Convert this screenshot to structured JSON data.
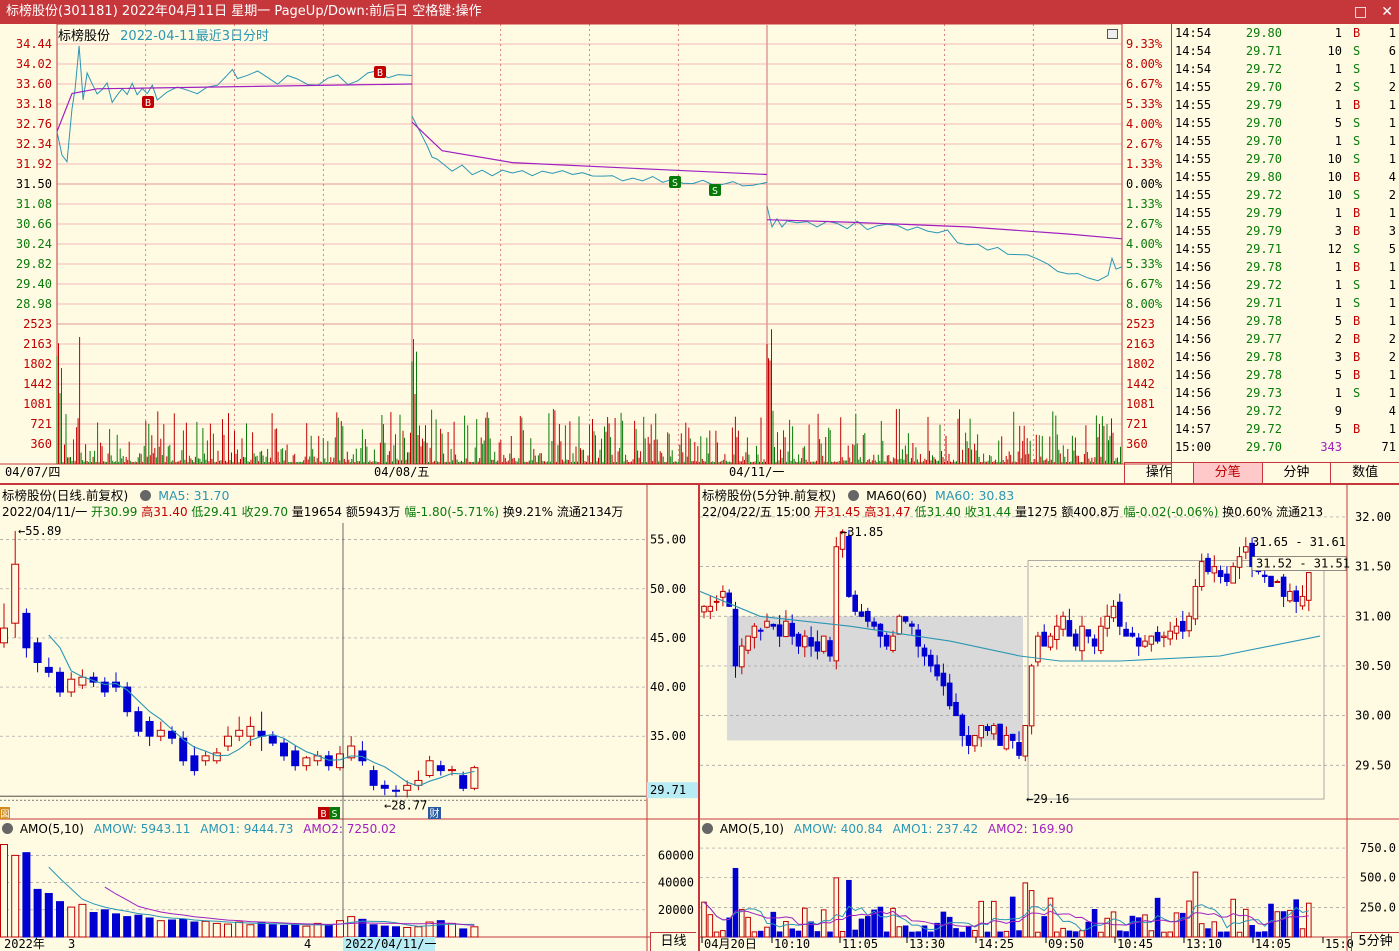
{
  "window": {
    "title": "标榜股份(301181) 2022年04月11日 星期一 PageUp/Down:前后日 空格键:操作",
    "min_glyph": "□",
    "close_glyph": "✕"
  },
  "intraday": {
    "stock_name": "标榜股份",
    "subtitle": "2022-04-11最近3日分时",
    "price_ticks": [
      "34.44",
      "34.02",
      "33.60",
      "33.18",
      "32.76",
      "32.34",
      "31.92",
      "31.50",
      "31.08",
      "30.66",
      "30.24",
      "29.82",
      "29.40",
      "28.98"
    ],
    "pct_ticks": [
      "9.33%",
      "8.00%",
      "6.67%",
      "5.33%",
      "4.00%",
      "2.67%",
      "1.33%",
      "0.00%",
      "1.33%",
      "2.67%",
      "4.00%",
      "5.33%",
      "6.67%",
      "8.00%"
    ],
    "volume_ticks": [
      "2523",
      "2163",
      "1802",
      "1442",
      "1081",
      "721",
      "360"
    ],
    "date_labels": [
      "04/07/四",
      "04/08/五",
      "04/11/一"
    ],
    "marker_b": "B",
    "marker_s": "S",
    "colors": {
      "up": "#c00000",
      "down": "#087a08",
      "price_line": "#2a96b4",
      "avg_line": "#a020c0"
    }
  },
  "tick_table": {
    "rows": [
      [
        "14:54",
        "29.80",
        "1",
        "B",
        "1"
      ],
      [
        "14:54",
        "29.71",
        "10",
        "S",
        "6"
      ],
      [
        "14:54",
        "29.72",
        "1",
        "S",
        "1"
      ],
      [
        "14:55",
        "29.70",
        "2",
        "S",
        "2"
      ],
      [
        "14:55",
        "29.79",
        "1",
        "B",
        "1"
      ],
      [
        "14:55",
        "29.70",
        "5",
        "S",
        "1"
      ],
      [
        "14:55",
        "29.70",
        "1",
        "S",
        "1"
      ],
      [
        "14:55",
        "29.70",
        "10",
        "S",
        "1"
      ],
      [
        "14:55",
        "29.80",
        "10",
        "B",
        "4"
      ],
      [
        "14:55",
        "29.72",
        "10",
        "S",
        "2"
      ],
      [
        "14:55",
        "29.79",
        "1",
        "B",
        "1"
      ],
      [
        "14:55",
        "29.79",
        "3",
        "B",
        "3"
      ],
      [
        "14:55",
        "29.71",
        "12",
        "S",
        "5"
      ],
      [
        "14:56",
        "29.78",
        "1",
        "B",
        "1"
      ],
      [
        "14:56",
        "29.72",
        "1",
        "S",
        "1"
      ],
      [
        "14:56",
        "29.71",
        "1",
        "S",
        "1"
      ],
      [
        "14:56",
        "29.78",
        "5",
        "B",
        "1"
      ],
      [
        "14:56",
        "29.77",
        "2",
        "B",
        "2"
      ],
      [
        "14:56",
        "29.78",
        "3",
        "B",
        "2"
      ],
      [
        "14:56",
        "29.78",
        "5",
        "B",
        "1"
      ],
      [
        "14:56",
        "29.73",
        "1",
        "S",
        "1"
      ],
      [
        "14:56",
        "29.72",
        "9",
        "",
        "4"
      ],
      [
        "14:57",
        "29.72",
        "5",
        "B",
        "1"
      ],
      [
        "15:00",
        "29.70",
        "343",
        "",
        "71"
      ]
    ],
    "tabs": [
      "操作",
      "分笔",
      "分钟",
      "数值"
    ],
    "active_tab": 1
  },
  "daily": {
    "title": "标榜股份(日线.前复权)",
    "ma_label": "MA5: 31.70",
    "info_line": {
      "date": "2022/04/11/一",
      "open": "开30.99",
      "high": "高31.40",
      "low": "低29.41",
      "close": "收29.70",
      "vol": "量19654",
      "amount": "额5943万",
      "change": "幅-1.80(-5.71%)",
      "turnover": "换9.21%",
      "float": "流通2134万"
    },
    "price_axis": [
      "55.00",
      "50.00",
      "45.00",
      "40.00",
      "35.00"
    ],
    "current_price": "29.71",
    "high_label": "55.89",
    "low_label": "28.77",
    "amo_title": "AMO(5,10)",
    "amow": "AMOW: 5943.11",
    "amo1": "AMO1: 9444.73",
    "amo2": "AMO2: 7250.02",
    "amo_axis": [
      "60000",
      "40000",
      "20000"
    ],
    "date_axis": [
      "2022年",
      "3",
      "4",
      "2022/04/11/一"
    ],
    "period_tab": "日线",
    "badge_b": "B",
    "badge_s": "S",
    "badge_cai": "财",
    "badge_left": "図",
    "daily_candles": [
      {
        "o": 44.5,
        "c": 46.0,
        "h": 48.5,
        "l": 44.0
      },
      {
        "o": 46.5,
        "c": 52.5,
        "h": 55.89,
        "l": 45.0
      },
      {
        "o": 47.5,
        "c": 44.0,
        "h": 48.0,
        "l": 43.0
      },
      {
        "o": 44.5,
        "c": 42.5,
        "h": 45.0,
        "l": 41.5
      },
      {
        "o": 42.0,
        "c": 41.5,
        "h": 43.0,
        "l": 41.0
      },
      {
        "o": 41.5,
        "c": 39.5,
        "h": 42.0,
        "l": 39.0
      },
      {
        "o": 39.5,
        "c": 40.8,
        "h": 41.5,
        "l": 39.0
      },
      {
        "o": 40.2,
        "c": 41.0,
        "h": 41.8,
        "l": 39.8
      },
      {
        "o": 41.0,
        "c": 40.5,
        "h": 41.5,
        "l": 40.0
      },
      {
        "o": 40.5,
        "c": 39.5,
        "h": 41.0,
        "l": 39.0
      },
      {
        "o": 40.5,
        "c": 40.0,
        "h": 41.5,
        "l": 39.5
      },
      {
        "o": 40.0,
        "c": 37.5,
        "h": 40.5,
        "l": 37.0
      },
      {
        "o": 37.5,
        "c": 35.5,
        "h": 38.0,
        "l": 35.0
      },
      {
        "o": 36.5,
        "c": 35.0,
        "h": 37.0,
        "l": 34.0
      },
      {
        "o": 35.0,
        "c": 35.6,
        "h": 36.5,
        "l": 34.5
      },
      {
        "o": 35.5,
        "c": 34.8,
        "h": 36.0,
        "l": 34.2
      },
      {
        "o": 34.8,
        "c": 32.5,
        "h": 35.5,
        "l": 32.0
      },
      {
        "o": 33.0,
        "c": 31.5,
        "h": 34.0,
        "l": 31.0
      },
      {
        "o": 32.5,
        "c": 33.0,
        "h": 33.5,
        "l": 32.0
      },
      {
        "o": 32.5,
        "c": 33.3,
        "h": 33.8,
        "l": 32.2
      },
      {
        "o": 34.0,
        "c": 35.0,
        "h": 36.0,
        "l": 33.5
      },
      {
        "o": 35.0,
        "c": 35.6,
        "h": 37.0,
        "l": 34.5
      },
      {
        "o": 35.0,
        "c": 36.0,
        "h": 37.0,
        "l": 34.0
      },
      {
        "o": 35.5,
        "c": 35.0,
        "h": 37.5,
        "l": 33.5
      },
      {
        "o": 35.0,
        "c": 34.3,
        "h": 35.5,
        "l": 34.0
      },
      {
        "o": 34.3,
        "c": 33.0,
        "h": 34.8,
        "l": 32.5
      },
      {
        "o": 33.5,
        "c": 32.0,
        "h": 34.0,
        "l": 31.5
      },
      {
        "o": 32.0,
        "c": 32.8,
        "h": 33.0,
        "l": 31.5
      },
      {
        "o": 32.5,
        "c": 33.0,
        "h": 33.5,
        "l": 32.0
      },
      {
        "o": 33.0,
        "c": 32.0,
        "h": 33.5,
        "l": 31.5
      },
      {
        "o": 31.8,
        "c": 33.2,
        "h": 34.0,
        "l": 31.5
      },
      {
        "o": 32.8,
        "c": 34.0,
        "h": 35.0,
        "l": 32.5
      },
      {
        "o": 33.5,
        "c": 32.5,
        "h": 34.5,
        "l": 32.0
      },
      {
        "o": 31.5,
        "c": 30.0,
        "h": 32.0,
        "l": 29.5
      },
      {
        "o": 30.0,
        "c": 29.7,
        "h": 30.5,
        "l": 29.0
      },
      {
        "o": 29.5,
        "c": 29.4,
        "h": 30.0,
        "l": 28.8
      },
      {
        "o": 29.5,
        "c": 30.0,
        "h": 30.5,
        "l": 28.77
      },
      {
        "o": 30.0,
        "c": 30.5,
        "h": 31.5,
        "l": 29.5
      },
      {
        "o": 31.0,
        "c": 32.5,
        "h": 33.0,
        "l": 30.8
      },
      {
        "o": 32.0,
        "c": 31.5,
        "h": 32.5,
        "l": 31.0
      },
      {
        "o": 31.5,
        "c": 31.6,
        "h": 32.0,
        "l": 31.0
      },
      {
        "o": 30.99,
        "c": 29.7,
        "h": 31.4,
        "l": 29.41
      },
      {
        "o": 29.7,
        "c": 31.8,
        "h": 32.0,
        "l": 29.5
      }
    ],
    "daily_amo": [
      68000,
      60000,
      62000,
      35000,
      32000,
      26000,
      22000,
      24000,
      18000,
      20000,
      17000,
      15000,
      16000,
      14000,
      12000,
      12500,
      13000,
      11000,
      11500,
      10000,
      9500,
      11000,
      9000,
      10500,
      9000,
      8500,
      9000,
      8000,
      10000,
      8500,
      12000,
      15000,
      13000,
      9000,
      8000,
      7500,
      7000,
      7500,
      11000,
      12000,
      10000,
      5943,
      7500
    ]
  },
  "m5": {
    "title": "标榜股份(5分钟.前复权)",
    "ma_label": "MA60(60)",
    "ma_value": "MA60: 30.83",
    "info_line": {
      "date": "22/04/22/五",
      "time": "15:00",
      "open": "开31.45",
      "high": "高31.47",
      "low": "低31.40",
      "close": "收31.44",
      "vol": "量1275",
      "amount": "额400.8万",
      "change": "幅-0.02(-0.06%)",
      "turnover": "换0.60%",
      "float": "流通213"
    },
    "price_axis": [
      "32.00",
      "31.50",
      "31.00",
      "30.50",
      "30.00",
      "29.50"
    ],
    "high_label": "31.85",
    "low_label": "29.16",
    "range1": "31.65 - 31.61",
    "range2": "31.52 - 31.51",
    "amo_title": "AMO(5,10)",
    "amow": "AMOW: 400.84",
    "amo1": "AMO1: 237.42",
    "amo2": "AMO2: 169.90",
    "amo_axis": [
      "750.0",
      "500.0",
      "250.0"
    ],
    "time_axis": [
      "04月20日",
      "10:10",
      "11:05",
      "13:30",
      "14:25",
      "09:50",
      "10:45",
      "13:10",
      "14:05",
      "15:0"
    ],
    "period_tab": "5分钟",
    "m5_closes": [
      31.1,
      31.1,
      31.15,
      31.25,
      31.1,
      30.5,
      30.7,
      30.8,
      30.9,
      30.85,
      30.95,
      30.9,
      30.8,
      30.95,
      30.8,
      30.7,
      30.8,
      30.7,
      30.65,
      30.8,
      30.6,
      31.7,
      31.85,
      31.2,
      31.05,
      31.0,
      30.95,
      30.9,
      30.8,
      30.7,
      30.8,
      31.0,
      30.95,
      30.9,
      30.7,
      30.6,
      30.5,
      30.4,
      30.3,
      30.1,
      30.0,
      29.8,
      29.7,
      29.8,
      29.9,
      29.85,
      29.9,
      29.7,
      29.8,
      29.75,
      29.6,
      29.9,
      30.5,
      30.8,
      30.7,
      30.8,
      30.9,
      31.0,
      30.8,
      30.7,
      30.9,
      30.8,
      30.7,
      30.9,
      31.0,
      31.1,
      30.9,
      30.8,
      30.8,
      30.7,
      30.75,
      30.8,
      30.75,
      30.8,
      30.85,
      30.9,
      30.85,
      31.0,
      31.3,
      31.55,
      31.45,
      31.5,
      31.4,
      31.35,
      31.5,
      31.6,
      31.7,
      31.5,
      31.45,
      31.4,
      31.3,
      31.35,
      31.2,
      31.25,
      31.15,
      31.2,
      31.44
    ]
  }
}
